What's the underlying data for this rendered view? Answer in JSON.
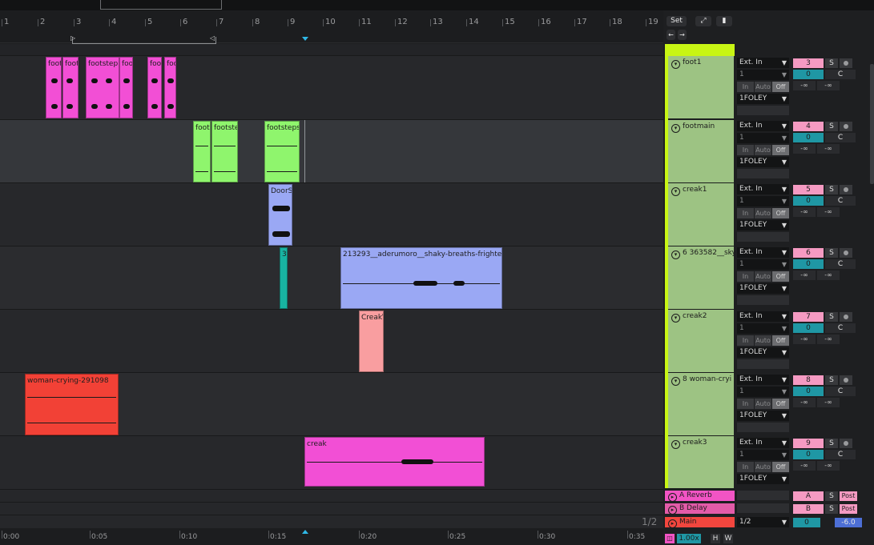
{
  "ruler": {
    "beats": [
      "1",
      "2",
      "3",
      "4",
      "5",
      "6",
      "7",
      "8",
      "9",
      "10",
      "11",
      "12",
      "13",
      "14",
      "15",
      "16",
      "17",
      "18",
      "19"
    ]
  },
  "set_controls": {
    "set_label": "Set",
    "expand_icon": "expand-icon",
    "lock_icon": "lock-icon"
  },
  "nav": {
    "back_label": "←",
    "forward_label": "→"
  },
  "tracks": [
    {
      "name": "foot1",
      "number": "3",
      "input": "Ext. In",
      "channel": "1",
      "output": "1FOLEY",
      "clips": [
        "foot",
        "foot",
        "footstep",
        "foot",
        "foot",
        "foot"
      ]
    },
    {
      "name": "footmain",
      "number": "4",
      "input": "Ext. In",
      "channel": "1",
      "output": "1FOLEY",
      "clips": [
        "foot",
        "footste",
        "footsteps"
      ]
    },
    {
      "name": "creak1",
      "number": "5",
      "input": "Ext. In",
      "channel": "1",
      "output": "1FOLEY",
      "clips": [
        "DoorS"
      ]
    },
    {
      "name": "6 363582__sky",
      "number": "6",
      "input": "Ext. In",
      "channel": "1",
      "output": "1FOLEY",
      "clips": [
        "36",
        "213293__aderumoro__shaky-breaths-frighte"
      ]
    },
    {
      "name": "creak2",
      "number": "7",
      "input": "Ext. In",
      "channel": "1",
      "output": "1FOLEY",
      "clips": [
        "CreakV"
      ]
    },
    {
      "name": "8 woman-cryi",
      "number": "8",
      "input": "Ext. In",
      "channel": "1",
      "output": "1FOLEY",
      "clips": [
        "woman-crying-291098"
      ]
    },
    {
      "name": "creak3",
      "number": "9",
      "input": "Ext. In",
      "channel": "1",
      "output": "1FOLEY",
      "clips": [
        "creak"
      ]
    }
  ],
  "track_common": {
    "solo": "S",
    "volume": "0",
    "pan": "C",
    "send_a": "-∞",
    "send_b": "-∞",
    "mon_in": "In",
    "mon_auto": "Auto",
    "mon_off": "Off"
  },
  "returns": [
    {
      "name": "A Reverb",
      "letter": "A",
      "solo": "S",
      "post": "Post",
      "color": "#f254c4"
    },
    {
      "name": "B Delay",
      "letter": "B",
      "solo": "S",
      "post": "Post",
      "color": "#e35ba8"
    }
  ],
  "main": {
    "name": "Main",
    "output": "1/2",
    "volume": "0",
    "peak": "-6.0",
    "color": "#f2463e"
  },
  "page_indicator": "1/2",
  "timeline": [
    "0:00",
    "0:05",
    "0:10",
    "0:15",
    "0:20",
    "0:25",
    "0:30",
    "0:35"
  ],
  "zoom": {
    "value": "1.00x",
    "h_label": "H",
    "w_label": "W"
  },
  "colors": {
    "green": "#9dc383",
    "pink": "#f24fd5",
    "lime": "#8ff56d",
    "lavender": "#9aa8f4",
    "teal": "#18b3a1",
    "salmon": "#f99ea0",
    "red": "#f24136",
    "select": "#c8f514"
  }
}
